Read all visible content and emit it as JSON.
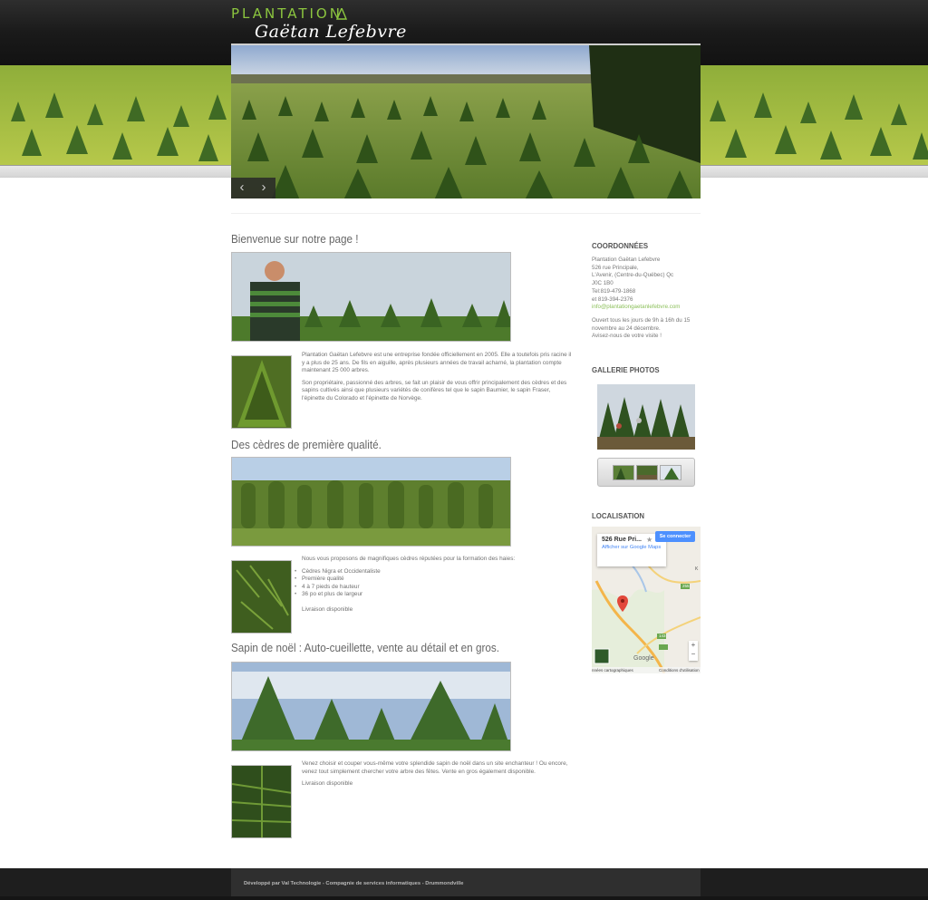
{
  "brand": {
    "line1": "PLANTATION",
    "line2": "Gaëtan Lefebvre"
  },
  "slider": {
    "prev": "‹",
    "next": "›"
  },
  "sections": [
    {
      "title": "Bienvenue sur notre page !",
      "paragraphs": [
        "Plantation Gaëtan Lefebvre est une entreprise fondée officiellement en 2005. Elle a toutefois pris racine il y a plus de 25 ans. De fils en aiguille, après plusieurs années de travail acharné, la plantation compte maintenant 25 000 arbres.",
        "Son propriétaire, passionné des arbres, se fait un plaisir de vous offrir principalement des cèdres et des sapins cultivés ainsi que plusieurs variétés de conifères tel que le sapin Baumier, le sapin Fraser, l'épinette du Colorado et l'épinette de Norvège."
      ]
    },
    {
      "title": "Des cèdres de première qualité.",
      "intro": "Nous vous proposons de magnifiques cèdres réputées pour la formation des haies:",
      "bullets": [
        "Cèdres Nigra et Occidentaliste",
        "Première qualité",
        "4 à 7 pieds de hauteur",
        "36 po et plus de largeur"
      ],
      "note": "Livraison disponible"
    },
    {
      "title": "Sapin de noël : Auto-cueillette, vente au détail et en gros.",
      "intro": "Venez choisir et couper vous-même votre splendide sapin de noël dans un site enchanteur ! Ou encore, venez tout simplement chercher votre arbre des fêtes. Vente en gros également disponible.",
      "note": "Livraison disponible"
    }
  ],
  "sidebar": {
    "contact_title": "COORDONNÉES",
    "contact_lines": [
      "Plantation Gaëtan Lefebvre",
      "526 rue Principale,",
      "L'Avenir, (Centre-du-Québec) Qc",
      "J0C 1B0",
      "Tel:819-479-1868",
      "et 819-394-2376"
    ],
    "email": "info@plantationgaetanlefebvre.com",
    "hours": "Ouvert tous les jours de 9h à 16h du 15 novembre au 24 décembre.",
    "hours2": "Avisez-nous de votre visite !",
    "gallery_title": "GALLERIE PHOTOS",
    "map_title": "LOCALISATION",
    "map": {
      "place": "526 Rue Pri...",
      "link": "Afficher sur Google Maps",
      "signin": "Se connecter",
      "footer_left": "nnées cartographiques",
      "footer_right": "Conditions d'utilisation",
      "logo": "Google",
      "route_a": "255",
      "route_b": "143",
      "route_c": "K"
    }
  },
  "footer": {
    "text": "Développé par Val Technologie - Compagnie de services informatiques - Drummondville"
  },
  "colors": {
    "accent_green": "#8cc63f",
    "header_dark": "#1a1a1a",
    "link": "#8bbf59"
  }
}
